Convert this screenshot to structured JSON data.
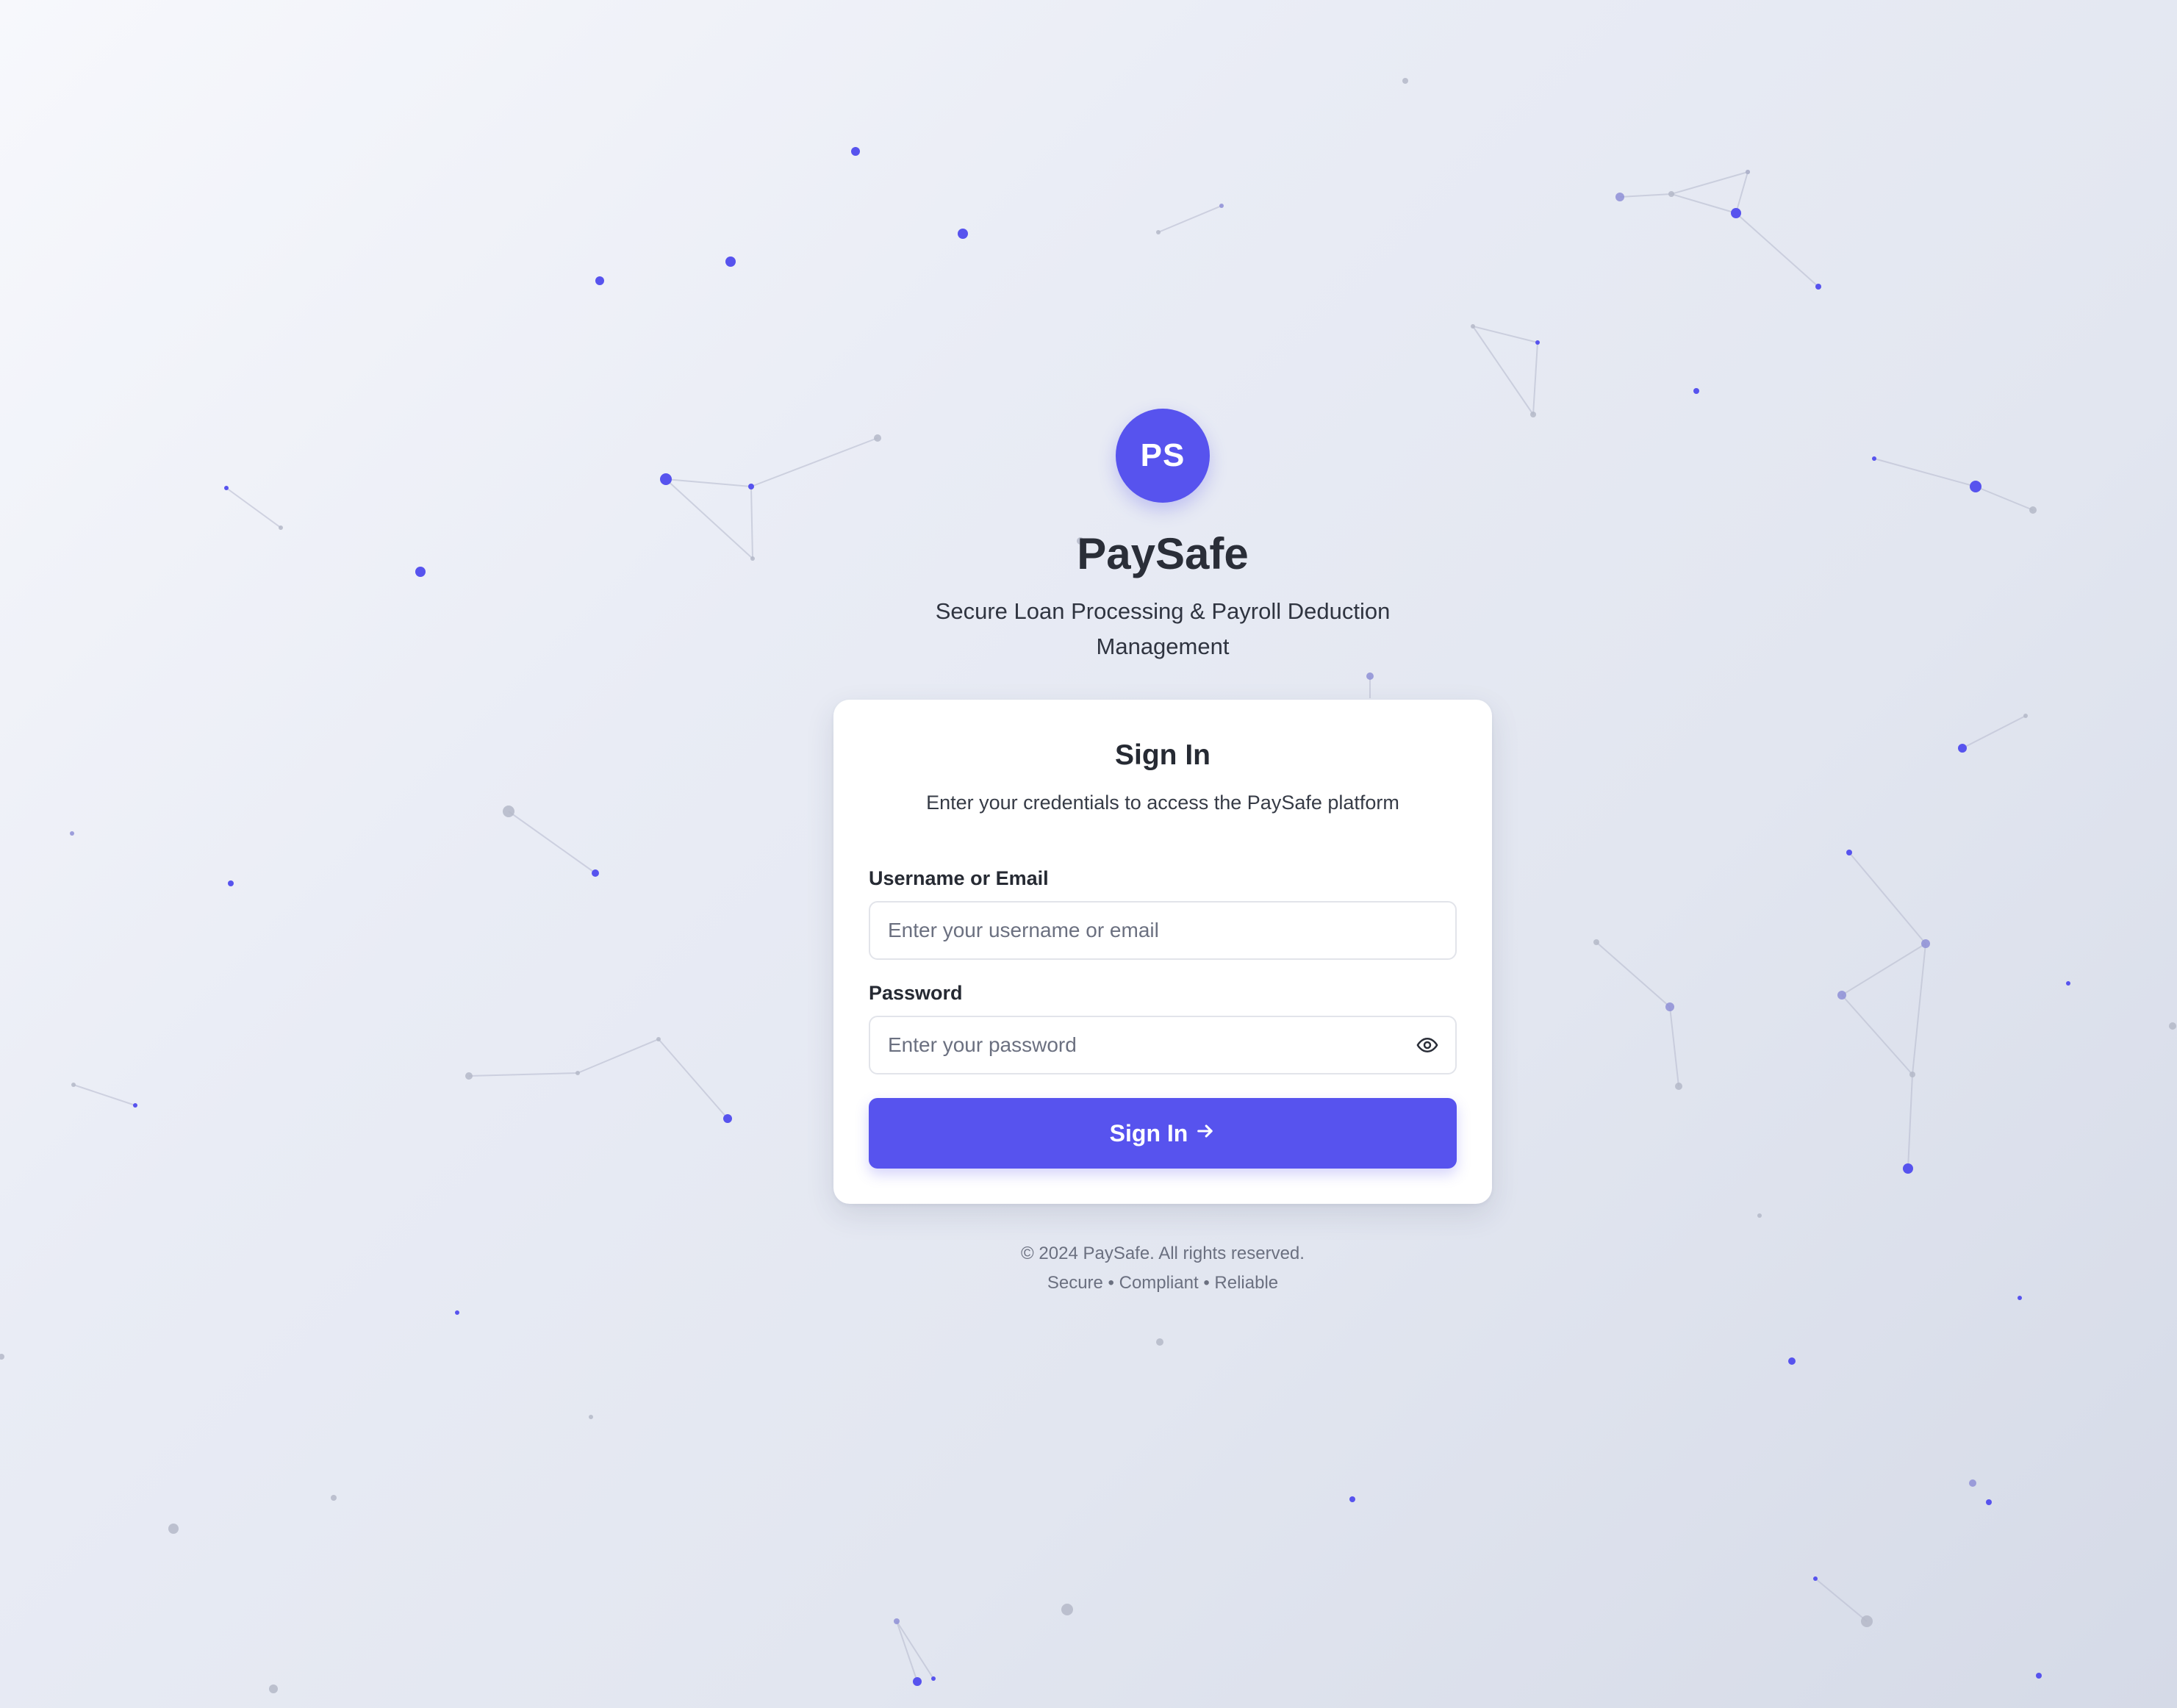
{
  "brand": {
    "logo_initials": "PS",
    "name": "PaySafe",
    "tagline": "Secure Loan Processing & Payroll Deduction Management",
    "accent_color": "#5753ee"
  },
  "signin_card": {
    "title": "Sign In",
    "description": "Enter your credentials to access the PaySafe platform",
    "username": {
      "label": "Username or Email",
      "placeholder": "Enter your username or email",
      "value": ""
    },
    "password": {
      "label": "Password",
      "placeholder": "Enter your password",
      "value": "",
      "toggle_icon": "eye-icon"
    },
    "submit_label": "Sign In",
    "submit_icon": "arrow-right-icon"
  },
  "footer": {
    "copyright": "© 2024 PaySafe. All rights reserved.",
    "tagline": "Secure • Compliant • Reliable"
  }
}
